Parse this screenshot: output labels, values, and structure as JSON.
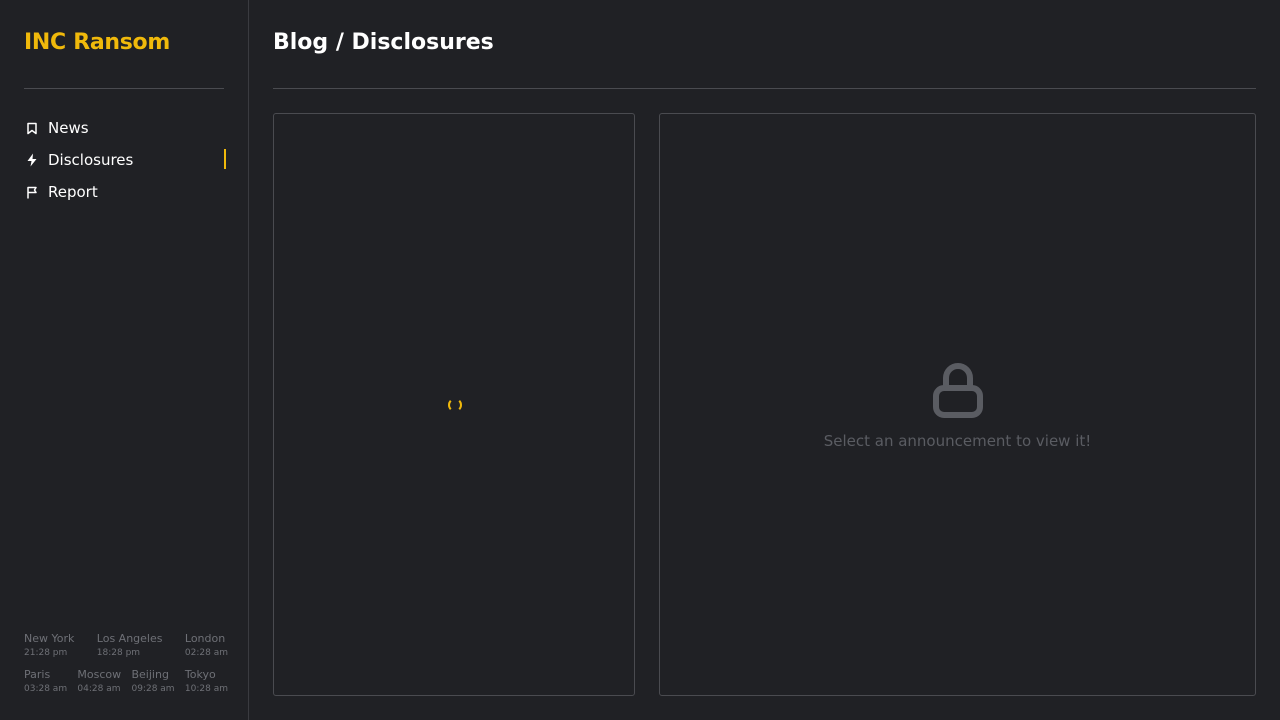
{
  "brand": {
    "name": "INC Ransom"
  },
  "nav": [
    {
      "label": "News",
      "icon": "bookmark-icon"
    },
    {
      "label": "Disclosures",
      "icon": "lightning-bolt-icon",
      "active": true
    },
    {
      "label": "Report",
      "icon": "flag-icon"
    }
  ],
  "page": {
    "title": "Blog / Disclosures"
  },
  "viewer": {
    "empty_message": "Select an announcement to view it!",
    "icon": "lock-icon"
  },
  "clocks": [
    {
      "city": "New York",
      "time": "21:28 pm"
    },
    {
      "city": "Los Angeles",
      "time": "18:28 pm"
    },
    {
      "city": "London",
      "time": "02:28 am"
    },
    {
      "city": "Paris",
      "time": "03:28 am"
    },
    {
      "city": "Moscow",
      "time": "04:28 am"
    },
    {
      "city": "Beijing",
      "time": "09:28 am"
    },
    {
      "city": "Tokyo",
      "time": "10:28 am"
    }
  ],
  "colors": {
    "accent": "#f0b90b",
    "background": "#202125",
    "border": "#4a4b50",
    "muted": "#5a5c62"
  }
}
